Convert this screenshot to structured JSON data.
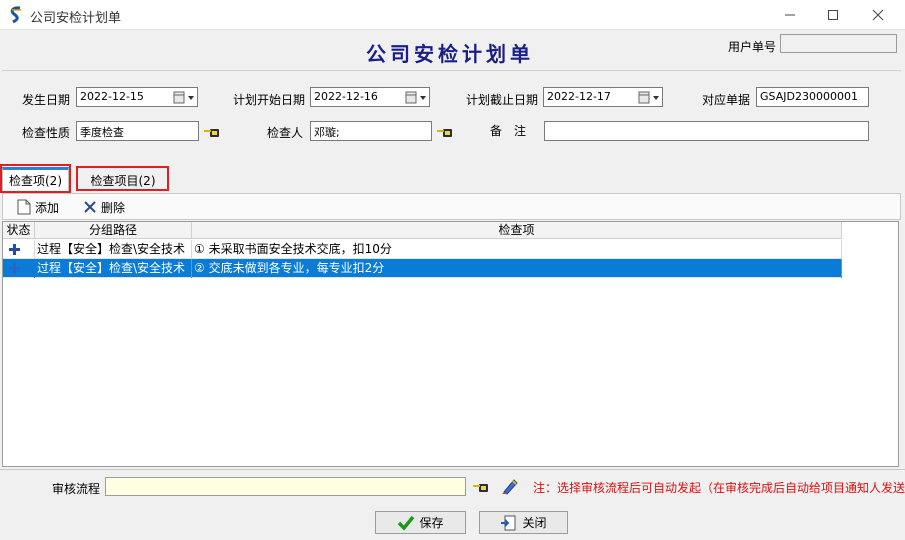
{
  "window": {
    "title": "公司安检计划单"
  },
  "form": {
    "heading": "公司安检计划单",
    "user_no_label": "用户单号",
    "user_no_value": "",
    "occur_date_label": "发生日期",
    "occur_date_value": "2022-12-15",
    "plan_start_label": "计划开始日期",
    "plan_start_value": "2022-12-16",
    "plan_end_label": "计划截止日期",
    "plan_end_value": "2022-12-17",
    "ref_doc_label": "对应单据",
    "ref_doc_value": "GSAJD230000001",
    "check_nature_label": "检查性质",
    "check_nature_value": "季度检查",
    "inspector_label": "检查人",
    "inspector_value": "邓璇;",
    "remark_label": "备　注",
    "remark_value": ""
  },
  "tabs": [
    {
      "label": "检查项(2)",
      "active": true
    },
    {
      "label": "检查项目(2)",
      "active": false
    }
  ],
  "toolbar": {
    "add_label": "添加",
    "delete_label": "删除"
  },
  "grid": {
    "columns": [
      "状态",
      "分组路径",
      "检查项"
    ],
    "rows": [
      {
        "status_icon": "plus-icon",
        "path": "过程【安全】检查\\安全技术",
        "item": "① 未采取书面安全技术交底，扣10分",
        "selected": false
      },
      {
        "status_icon": "plus-icon",
        "path": "过程【安全】检查\\安全技术",
        "item": "② 交底未做到各专业，每专业扣2分",
        "selected": true
      }
    ]
  },
  "footer": {
    "flow_label": "审核流程",
    "flow_value": "",
    "note": "注：选择审核流程后可自动发起（在审核完成后自动给项目通知人发送",
    "save_label": "保存",
    "close_label": "关闭"
  },
  "colors": {
    "heading": "#1a1f86",
    "selection": "#0a7bd6",
    "note": "#e01010",
    "highlight_box": "#e02020"
  }
}
